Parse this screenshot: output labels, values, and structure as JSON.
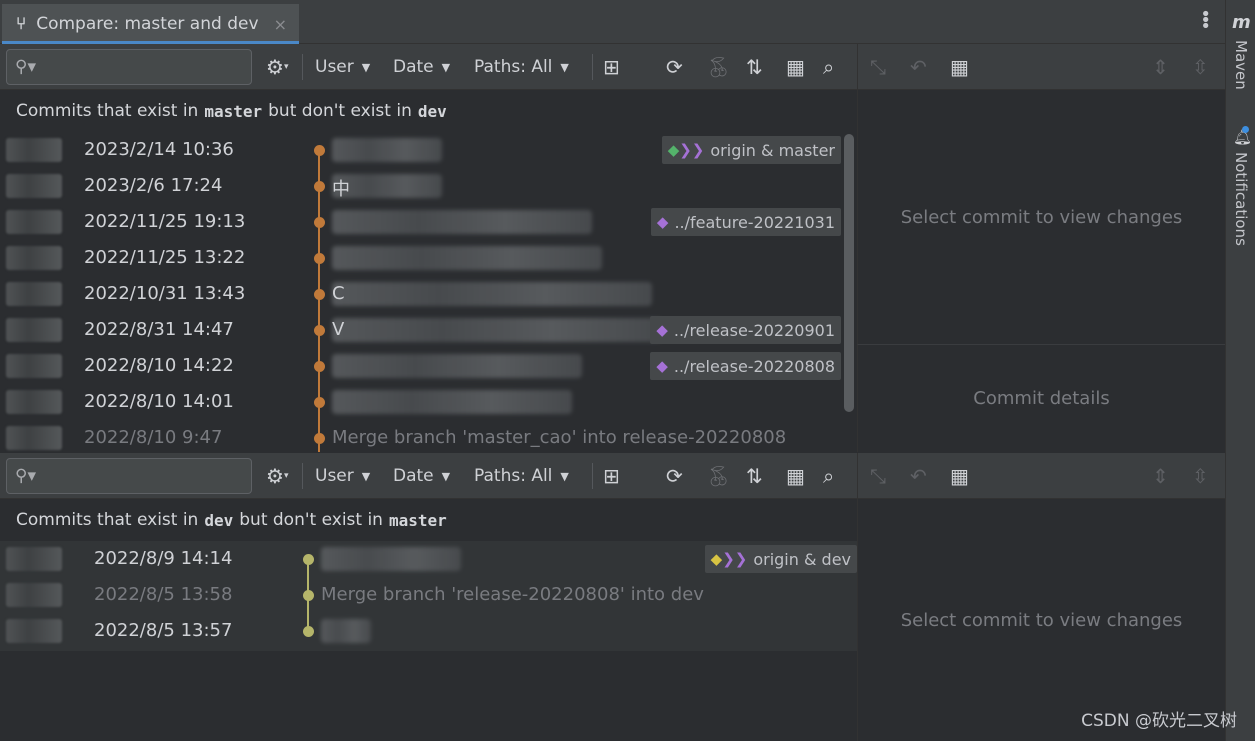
{
  "window": {
    "tab_title": "Compare: master and dev",
    "tab_close": "×",
    "more": "⋮"
  },
  "right_strip": {
    "maven_logo": "m",
    "maven": "Maven",
    "notifications": "Notifications"
  },
  "toolbar": {
    "user": "User",
    "date": "Date",
    "paths": "Paths: All",
    "search_placeholder": ""
  },
  "panel_top": {
    "header_prefix": "Commits that exist in",
    "branch_a": "master",
    "header_middle": "but don't exist in",
    "branch_b": "dev",
    "commits": [
      {
        "date": "2023/2/14 10:36",
        "msg": "",
        "label": "origin & master",
        "dim": false
      },
      {
        "date": "2023/2/6 17:24",
        "msg": "中",
        "label": "",
        "dim": false
      },
      {
        "date": "2022/11/25 19:13",
        "msg": "",
        "label": "../feature-20221031",
        "dim": false
      },
      {
        "date": "2022/11/25 13:22",
        "msg": "",
        "label": "",
        "dim": false
      },
      {
        "date": "2022/10/31 13:43",
        "msg": "C",
        "label": "",
        "dim": false
      },
      {
        "date": "2022/8/31 14:47",
        "msg": "V",
        "label": "../release-20220901",
        "dim": false
      },
      {
        "date": "2022/8/10 14:22",
        "msg": "",
        "label": "../release-20220808",
        "dim": false
      },
      {
        "date": "2022/8/10 14:01",
        "msg": "",
        "label": "",
        "dim": false
      },
      {
        "date": "2022/8/10 9:47",
        "msg": "Merge branch 'master_cao' into release-20220808",
        "label": "",
        "dim": true
      }
    ],
    "empty_changes": "Select commit to view changes",
    "commit_details": "Commit details"
  },
  "panel_bottom": {
    "header_prefix": "Commits that exist in",
    "branch_a": "dev",
    "header_middle": "but don't exist in",
    "branch_b": "master",
    "commits": [
      {
        "date": "2022/8/9 14:14",
        "msg": "",
        "label": "origin & dev",
        "dim": false
      },
      {
        "date": "2022/8/5 13:58",
        "msg": "Merge branch 'release-20220808' into dev",
        "label": "",
        "dim": true
      },
      {
        "date": "2022/8/5 13:57",
        "msg": "",
        "label": "",
        "dim": false
      }
    ],
    "empty_changes": "Select commit to view changes"
  },
  "watermark": "CSDN @砍光二叉树",
  "colors": {
    "graph_top": "#c17a3a",
    "graph_bottom": "#b5b56a",
    "tag_purple": "#a571d6",
    "tag_green": "#54b36b",
    "tag_yellow": "#d8c443"
  }
}
